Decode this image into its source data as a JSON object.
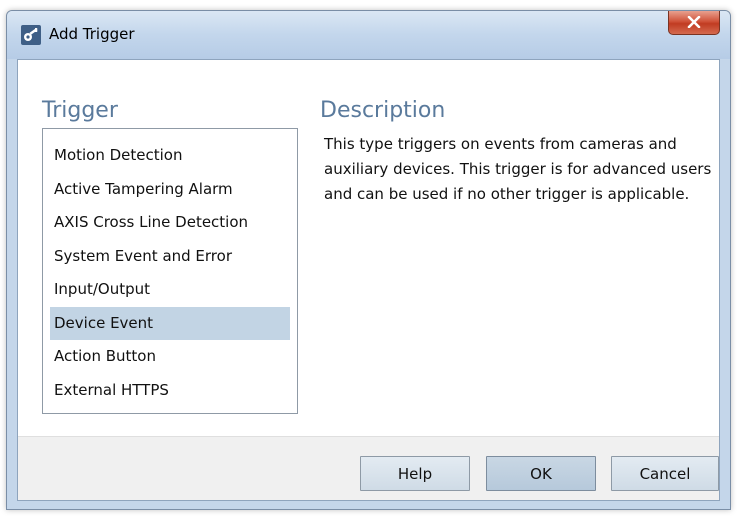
{
  "window": {
    "title": "Add Trigger",
    "title_icon": "trigger-key-icon",
    "close_icon": "close-icon",
    "close_color": "#c9462d"
  },
  "trigger": {
    "heading": "Trigger",
    "items": [
      {
        "label": "Motion Detection",
        "selected": false
      },
      {
        "label": "Active Tampering Alarm",
        "selected": false
      },
      {
        "label": "AXIS Cross Line Detection",
        "selected": false
      },
      {
        "label": "System Event and Error",
        "selected": false
      },
      {
        "label": "Input/Output",
        "selected": false
      },
      {
        "label": "Device Event",
        "selected": true
      },
      {
        "label": "Action Button",
        "selected": false
      },
      {
        "label": "External HTTPS",
        "selected": false
      }
    ]
  },
  "description": {
    "heading": "Description",
    "text": "This type triggers on events from cameras and auxiliary devices. This trigger is for advanced users and can be used if no other trigger is applicable."
  },
  "buttons": {
    "help": "Help",
    "ok": "OK",
    "cancel": "Cancel"
  },
  "colors": {
    "heading": "#5a7a9c",
    "selection": "#c2d4e4",
    "titlebar": "#c3d6ec"
  }
}
